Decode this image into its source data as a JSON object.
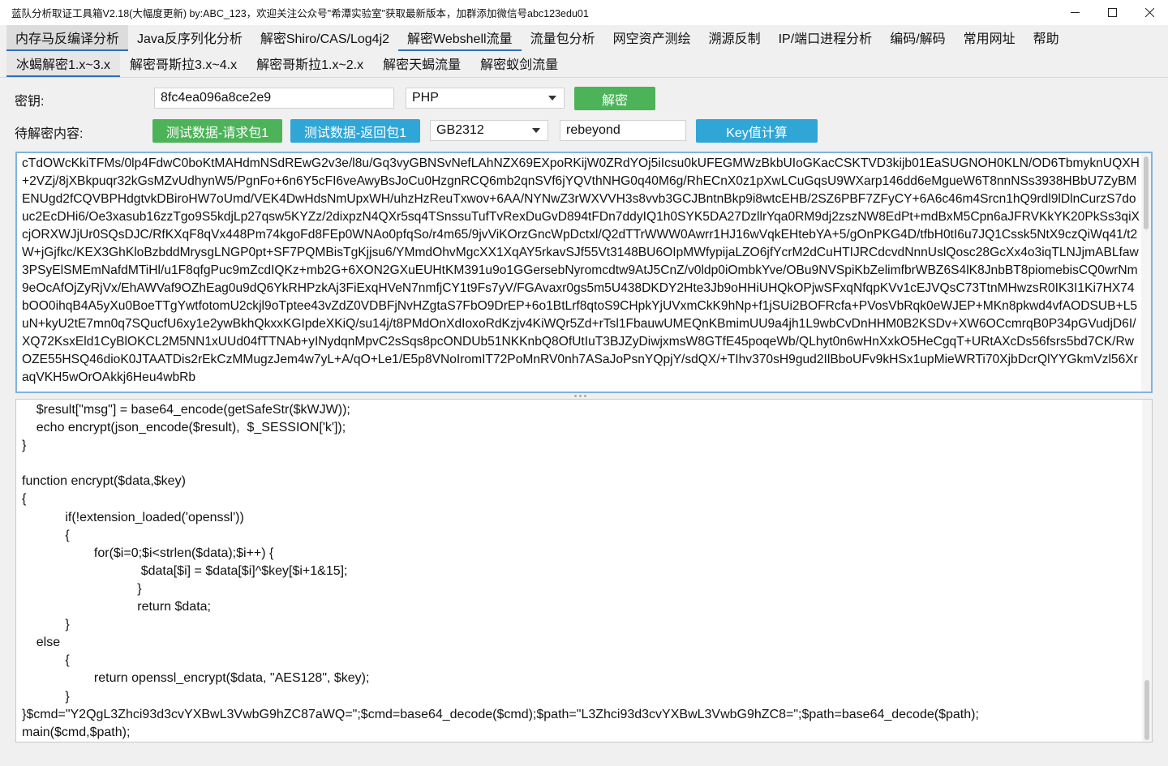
{
  "window": {
    "title": "蓝队分析取证工具箱V2.18(大幅度更新) by:ABC_123，欢迎关注公众号\"希潭实验室\"获取最新版本，加群添加微信号abc123edu01"
  },
  "menu": {
    "tabs": [
      {
        "label": "内存马反编译分析"
      },
      {
        "label": "Java反序列化分析"
      },
      {
        "label": "解密Shiro/CAS/Log4j2"
      },
      {
        "label": "解密Webshell流量"
      },
      {
        "label": "流量包分析"
      },
      {
        "label": "网空资产测绘"
      },
      {
        "label": "溯源反制"
      },
      {
        "label": "IP/端口进程分析"
      },
      {
        "label": "编码/解码"
      },
      {
        "label": "常用网址"
      },
      {
        "label": "帮助"
      }
    ],
    "selected": "解密Webshell流量"
  },
  "subtabs": [
    {
      "label": "冰蝎解密1.x~3.x"
    },
    {
      "label": "解密哥斯拉3.x~4.x"
    },
    {
      "label": "解密哥斯拉1.x~2.x"
    },
    {
      "label": "解密天蝎流量"
    },
    {
      "label": "解密蚁剑流量"
    }
  ],
  "form": {
    "key_label": "密钥:",
    "key_value": "8fc4ea096a8ce2e9",
    "lang_value": "PHP",
    "decrypt_button": "解密",
    "content_label": "待解密内容:",
    "test_request_button": "测试数据-请求包1",
    "test_response_button": "测试数据-返回包1",
    "encoding_value": "GB2312",
    "password_value": "rebeyond",
    "keycalc_button": "Key值计算"
  },
  "ciphertext": "cTdOWcKkiTFMs/0lp4FdwC0boKtMAHdmNSdREwG2v3e/l8u/Gq3vyGBNSvNefLAhNZX69EXpoRKijW0ZRdYOj5iIcsu0kUFEGMWzBkbUIoGKacCSKTVD3kijb01EaSUGNOH0KLN/OD6TbmyknUQXH+2VZj/8jXBkpuqr32kGsMZvUdhynW5/PgnFo+6n6Y5cFI6veAwyBsJoCu0HzgnRCQ6mb2qnSVf6jYQVthNHG0q40M6g/RhECnX0z1pXwLCuGqsU9WXarp146dd6eMgueW6T8nnNSs3938HBbU7ZyBMENUgd2fCQVBPHdgtvkDBiroHW7oUmd/VEK4DwHdsNmUpxWH/uhzHzReuTxwov+6AA/NYNwZ3rWXVVH3s8vvb3GCJBntnBkp9i8wtcEHB/2SZ6PBF7ZFyCY+6A6c46m4Srcn1hQ9rdl9lDlnCurzS7douc2EcDHi6/Oe3xasub16zzTgo9S5kdjLp27qsw5KYZz/2dixpzN4QXr5sq4TSnssuTufTvRexDuGvD894tFDn7ddyIQ1h0SYK5DA27DzllrYqa0RM9dj2zszNW8EdPt+mdBxM5Cpn6aJFRVKkYK20PkSs3qiXcjORXWJjUr0SQsDJC/RfKXqF8qVx448Pm74kgoFd8FEp0WNAo0pfqSo/r4m65/9jvViKOrzGncWpDctxl/Q2dTTrWWW0Awrr1HJ16wVqkEHtebYA+5/gOnPKG4D/tfbH0tI6u7JQ1Cssk5NtX9czQiWq41/t2W+jGjfkc/KEX3GhKloBzbddMrysgLNGP0pt+SF7PQMBisTgKjjsu6/YMmdOhvMgcXX1XqAY5rkavSJf55Vt3148BU6OIpMWfypijaLZO6jfYcrM2dCuHTIJRCdcvdNnnUslQosc28GcXx4o3iqTLNJjmABLfaw3PSyElSMEmNafdMTiHl/u1F8qfgPuc9mZcdIQKz+mb2G+6XON2GXuEUHtKM391u9o1GGersebNyromcdtw9AtJ5CnZ/v0ldp0iOmbkYve/OBu9NVSpiKbZelimfbrWBZ6S4lK8JnbBT8piomebisCQ0wrNm9eOcAfOjZyRjVx/EhAWVaf9OZhEag0u9dQ6YkRHPzkAj3FiExqHVeN7nmfjCY1t9Fs7yV/FGAvaxr0gs5m5U438DKDY2Hte3Jb9oHHiUHQkOPjwSFxqNfqpKVv1cEJVQsC73TtnMHwzsR0IK3I1Ki7HX74bOO0ihqB4A5yXu0BoeTTgYwtfotomU2ckjl9oTptee43vZdZ0VDBFjNvHZgtaS7FbO9DrEP+6o1BtLrf8qtoS9CHpkYjUVxmCkK9hNp+f1jSUi2BOFRcfa+PVosVbRqk0eWJEP+MKn8pkwd4vfAODSUB+L5uN+kyU2tE7mn0q7SQucfU6xy1e2ywBkhQkxxKGIpdeXKiQ/su14j/t8PMdOnXdIoxoRdKzjv4KiWQr5Zd+rTsl1FbauwUMEQnKBmimUU9a4jh1L9wbCvDnHHM0B2KSDv+XW6OCcmrqB0P34pGVudjD6I/XQ72KsxEld1CyBlOKCL2M5NN1xUUd04fTTNAb+yINydqnMpvC2sSqs8pcONDUb51NKKnbQ8OfUtIuT3BJZyDiwjxmsW8GTfE45poqeWb/QLhyt0n6wHnXxkO5HeCgqT+URtAXcDs56fsrs5bd7CK/RwOZE55HSQ46dioK0JTAATDis2rEkCzMMugzJem4w7yL+A/qO+Le1/E5p8VNoIromIT72PoMnRV0nh7ASaJoPsnYQpjY/sdQX/+TIhv370sH9gud2IlBboUFv9kHSx1upMieWRTi70XjbDcrQlYYGkmVzl56XraqVKH5wOrOAkkj6Heu4wbRb",
  "code_lines": [
    "    $result[\"msg\"] = base64_encode(getSafeStr($kWJW));",
    "    echo encrypt(json_encode($result),  $_SESSION['k']);",
    "}",
    "",
    "function encrypt($data,$key)",
    "{",
    "\t\t\tif(!extension_loaded('openssl'))",
    "\t\t\t{",
    "\t\t\t\t\tfor($i=0;$i<strlen($data);$i++) {",
    "\t\t\t\t\t\t\t\t $data[$i] = $data[$i]^$key[$i+1&15];",
    "\t\t\t\t\t\t\t\t}",
    "\t\t\t\t\t\t\t\treturn $data;",
    "\t\t\t}",
    "    else",
    "\t\t\t{",
    "\t\t\t\t\treturn openssl_encrypt($data, \"AES128\", $key);",
    "\t\t\t}",
    "}$cmd=\"Y2QgL3Zhci93d3cvYXBwL3VwbG9hZC87aWQ=\";$cmd=base64_decode($cmd);$path=\"L3Zhci93d3cvYXBwL3VwbG9hZC8=\";$path=base64_decode($path);",
    "main($cmd,$path);"
  ],
  "colors": {
    "green_button": "#4cb359",
    "blue_button": "#2fa6d6",
    "active_underline": "#2e6fb9",
    "focus_border": "#7fb3e0"
  }
}
